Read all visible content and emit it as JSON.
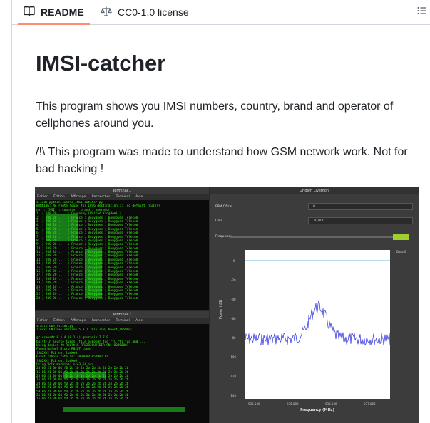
{
  "tabs": {
    "readme_label": "README",
    "license_label": "CC0-1.0 license"
  },
  "article": {
    "title": "IMSI-catcher",
    "paragraph1": "This program shows you IMSI numbers, country, brand and operator of cellphones around you.",
    "paragraph2": "/!\\ This program was made to understand how GSM network work. Not for bad hacking !"
  },
  "screenshot": {
    "terminal1": {
      "title": "Terminal 1",
      "menu": [
        "Fichier",
        "Édition",
        "Affichage",
        "Rechercher",
        "Terminal",
        "Aide"
      ],
      "lines": [
        "$ sudo python simple_IMSI-catcher.py",
        "WARNING: No route found for IPv6 destination :: (no default route?)",
        "nb  ; IMSI  ; country ; brand ; operator",
        "1  ; 208 20 ...  ; Guernsey (United Kingdom) ; ...",
        "2  ; 208 20 ...  ; France ; Bouygues ; Bouygues Telecom",
        "3  ; 208 20 ...  ; France ; Bouygues ; Bouygues Telecom",
        "4  ; 208 20 ...  ; France ; Bouygues ; Bouygues Telecom",
        "5  ; 208 20 ...  ; France ; Bouygues ; Bouygues Telecom",
        "6  ; 208 20 ...  ; France ; Bouygues ; Bouygues Telecom",
        "7  ; 208 20 ...  ; France ; Bouygues ; Bouygues Telecom",
        "8  ; 208 20 ...  ; France ; Bouygues ; Bouygues Telecom",
        "9  ; 208 20 ...  ; France ; Bouygues ; Bouygues Telecom",
        "10 ; 208 20 ...  ; France ; Bouygues ; Bouygues Telecom",
        "11 ; 208 20 ...  ; France ; Bouygues ; Bouygues Telecom",
        "12 ; 208 20 ...  ; France ; Bouygues ; Bouygues Telecom",
        "13 ; 208 20 ...  ; France ; Bouygues ; Bouygues Telecom",
        "14 ; 208 20 ...  ; France ; Bouygues ; Bouygues Telecom",
        "15 ; 208 20 ...  ; France ; Bouygues ; Bouygues Telecom",
        "16 ; 208 20 ...  ; France ; Bouygues ; Bouygues Telecom",
        "17 ; 208 20 ...  ; France ; Bouygues ; Bouygues Telecom",
        "18 ; 208 20 ...  ; France ; Bouygues ; Bouygues Telecom",
        "19 ; 208 20 ...  ; France ; Bouygues ; Bouygues Telecom",
        "20 ; 208 20 ...  ; France ; Bouygues ; Bouygues Telecom",
        "21 ; 208 20 ...  ; France ; Bouygues ; Bouygues Telecom",
        "22 ; 208 20 ...  ; France ; Bouygues ; Bouygues Telecom",
        "23 ; 208 20 ...  ; France ; Bouygues ; Bouygues Telecom"
      ]
    },
    "terminal2": {
      "title": "Terminal 2",
      "menu": [
        "Fichier",
        "Édition",
        "Affichage",
        "Rechercher",
        "Terminal",
        "Aide"
      ],
      "lines": [
        "$ airprobe_rtlsdr.py",
        "linux; GNU C++ version 5.3.1 20151219; Boost_105800; ...",
        "",
        "gr-osmosdr 0.1.4 (0.1.4) gnuradio 3.7.9",
        "built-in source types: file osmosdr fcd rtl rtl_tcp uhd ...",
        "Using device #0 Realtek RTL2838UHIDIR SN: 00000001",
        "Found Rafael Micro R820T tuner",
        "[R82XX] PLL not locked!",
        "Exact sample rate is: 2000000.052982 Hz",
        "[R82XX] PLL not locked!",
        "Using Volk machine: sse3_64_orc",
        "2d 06 21 00 01 f0 2b 2b 2b 2b 2b 2b 2b 2b 2b 2b 2b",
        "15 06 21 00 01 f0 2b 2b 2b 2b 2b 2b 2b 2b 2b 2b 2b",
        "25 06 21 00 01 f0 2b 2b 2b 2b 2b 2b 2b 2b 2b 2b 2b",
        "15 06 21 00 01 f0 2b 2b 2b 2b 2b 2b 2b 2b 2b 2b 2b",
        "2d 06 21 00 01 f0 2b 2b 2b 2b 2b 2b 2b 2b 2b 2b 2b",
        "2d 06 21 00 01 f0 2b 2b 2b 2b 2b 2b 2b 2b 2b 2b 2b",
        "59 06 21 00 01 f0 2b 2b 2b 2b 2b 2b 2b 2b 2b 2b 2b",
        "21 06 21 00 01 f0 2b 2b 2b 2b 2b 2b 2b 2b 2b 2b 2b",
        "15 06 21 00 01 f0 2b 2b 2b 2b 2b 2b 2b 2b 2b 2b 2b"
      ]
    },
    "grgsm": {
      "title": "Gr-gsm Livemon",
      "ppm_label": "PPM Offset",
      "ppm_value": "0",
      "gain_label": "Gain",
      "gain_value": "30,000",
      "freq_label": "Frequency",
      "ylabel": "Power (dB)",
      "xlabel": "Frequency (MHz)",
      "legend": "Data 0",
      "yticks": [
        "0",
        "-20",
        "-40",
        "-60",
        "-80",
        "-100",
        "-120",
        "-140"
      ],
      "xticks": [
        "935.500",
        "936.000",
        "936.500",
        "937.000"
      ]
    }
  }
}
